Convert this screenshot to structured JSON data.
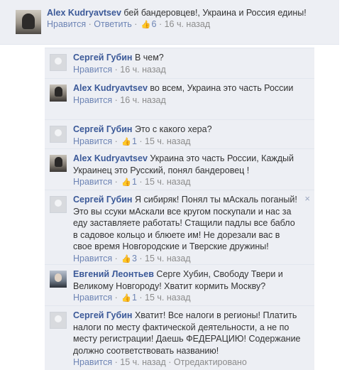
{
  "sep": " · ",
  "like_icon": "thumbs-up-icon",
  "top": {
    "author": "Alex Kudryavtsev",
    "text": "бей бандеровцев!, Украина и Россия едины!",
    "like_label": "Нравится",
    "reply_label": "Ответить",
    "likes": "6",
    "time": "16 ч. назад"
  },
  "replies": [
    {
      "author": "Сергей Губин",
      "text": "В чем?",
      "like_label": "Нравится",
      "likes": "",
      "time": "16 ч. назад"
    },
    {
      "author": "Alex Kudryavtsev",
      "text": "во всем, Украина это часть России",
      "like_label": "Нравится",
      "likes": "",
      "time": "16 ч. назад"
    },
    {
      "author": "Сергей Губин",
      "text": "Это с какого хера?",
      "like_label": "Нравится",
      "likes": "1",
      "time": "15 ч. назад"
    },
    {
      "author": "Alex Kudryavtsev",
      "text": "Украина это часть России, Каждый Украинец это Русский, понял бандеровец !",
      "like_label": "Нравится",
      "likes": "1",
      "time": "15 ч. назад"
    },
    {
      "author": "Сергей Губин",
      "text": "Я сибиряк! Понял ты мАскаль поганый! Это вы ссуки мАскали все кругом поскупали и нас за еду заставляете работать! Стащили падлы все бабло в садовое кольцо и блюете им! Не дорезали вас в свое время Новгородские и Тверские дружины!",
      "like_label": "Нравится",
      "likes": "3",
      "time": "15 ч. назад",
      "close": "×"
    },
    {
      "author": "Евгений Леонтьев",
      "text": "Серге Хубин, Свободу Твери и Великому Новгороду! Хватит кормить Москву?",
      "like_label": "Нравится",
      "likes": "1",
      "time": "15 ч. назад"
    },
    {
      "author": "Сергей Губин",
      "text": "Хватит! Все налоги в регионы! Платить налоги по месту фактической деятельности, а не по месту регистрации! Даешь ФЕДЕРАЦИЮ! Содержание должно соответствовать названию!",
      "like_label": "Нравится",
      "likes": "",
      "time": "15 ч. назад",
      "status": "Отредактировано"
    }
  ]
}
